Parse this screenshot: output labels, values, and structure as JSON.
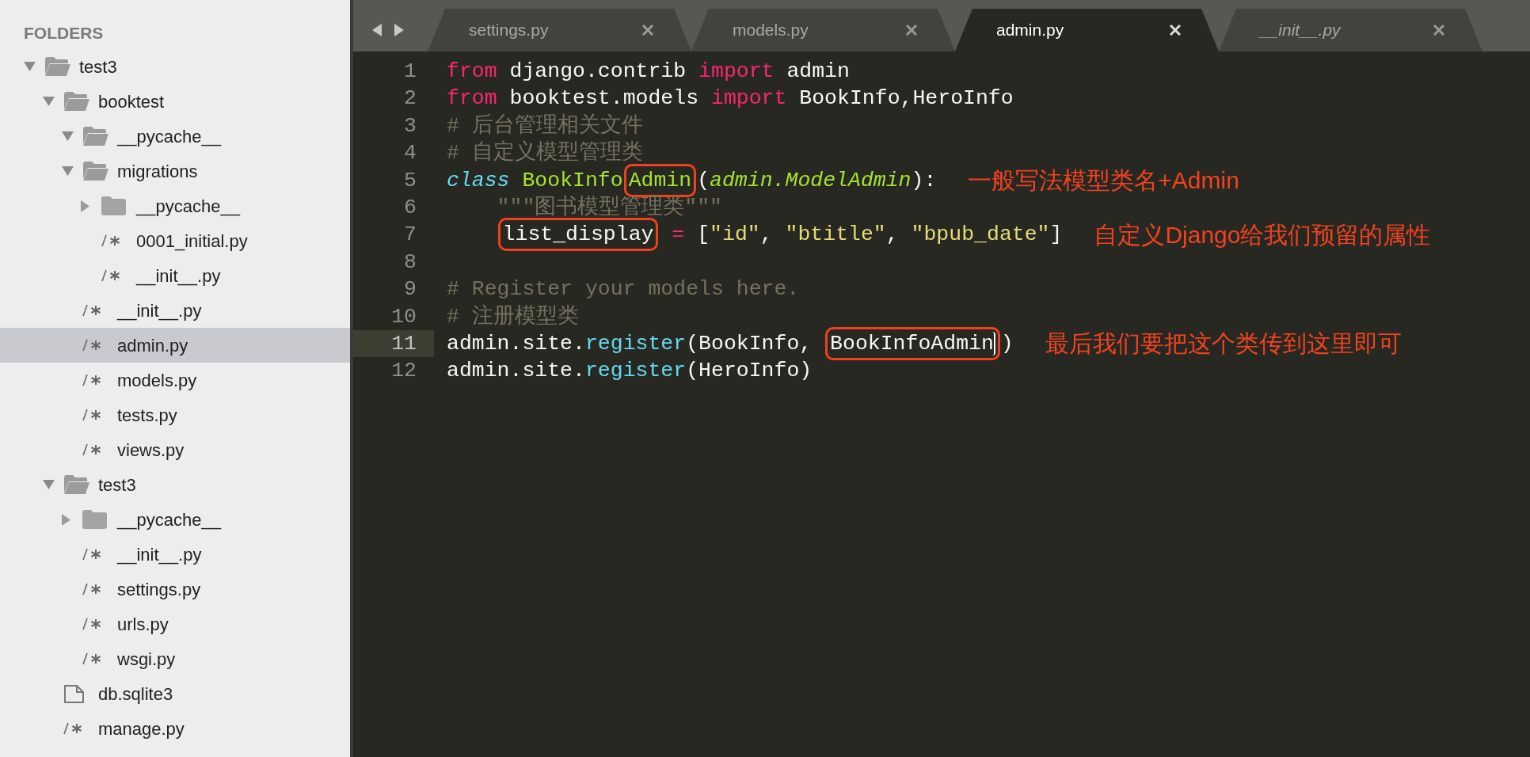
{
  "sidebar": {
    "header": "FOLDERS",
    "tree": [
      {
        "name": "test3",
        "kind": "folder",
        "expanded": true,
        "selected": false,
        "children": [
          {
            "name": "booktest",
            "kind": "folder",
            "expanded": true,
            "selected": false,
            "children": [
              {
                "name": "__pycache__",
                "kind": "folder",
                "expanded": true,
                "selected": false
              },
              {
                "name": "migrations",
                "kind": "folder",
                "expanded": true,
                "selected": false,
                "children": [
                  {
                    "name": "__pycache__",
                    "kind": "folder",
                    "expanded": false,
                    "selected": false
                  },
                  {
                    "name": "0001_initial.py",
                    "kind": "source",
                    "selected": false
                  },
                  {
                    "name": "__init__.py",
                    "kind": "source",
                    "selected": false
                  }
                ]
              },
              {
                "name": "__init__.py",
                "kind": "source",
                "selected": false
              },
              {
                "name": "admin.py",
                "kind": "source",
                "selected": true
              },
              {
                "name": "models.py",
                "kind": "source",
                "selected": false
              },
              {
                "name": "tests.py",
                "kind": "source",
                "selected": false
              },
              {
                "name": "views.py",
                "kind": "source",
                "selected": false
              }
            ]
          },
          {
            "name": "test3",
            "kind": "folder",
            "expanded": true,
            "selected": false,
            "children": [
              {
                "name": "__pycache__",
                "kind": "folder",
                "expanded": false,
                "selected": false
              },
              {
                "name": "__init__.py",
                "kind": "source",
                "selected": false
              },
              {
                "name": "settings.py",
                "kind": "source",
                "selected": false
              },
              {
                "name": "urls.py",
                "kind": "source",
                "selected": false
              },
              {
                "name": "wsgi.py",
                "kind": "source",
                "selected": false
              }
            ]
          },
          {
            "name": "db.sqlite3",
            "kind": "file",
            "selected": false
          },
          {
            "name": "manage.py",
            "kind": "source",
            "selected": false
          }
        ]
      }
    ]
  },
  "tabs": [
    {
      "label": "settings.py",
      "selected": false,
      "preview": false
    },
    {
      "label": "models.py",
      "selected": false,
      "preview": false
    },
    {
      "label": "admin.py",
      "selected": true,
      "preview": false
    },
    {
      "label": "__init__.py",
      "selected": false,
      "preview": true
    }
  ],
  "editor": {
    "lines": [
      {
        "number": "1",
        "current": false,
        "tokens": [
          {
            "text": "from",
            "kind": "keyword"
          },
          {
            "text": " django.contrib ",
            "kind": "plain"
          },
          {
            "text": "import",
            "kind": "keyword"
          },
          {
            "text": " admin",
            "kind": "plain"
          }
        ]
      },
      {
        "number": "2",
        "current": false,
        "tokens": [
          {
            "text": "from",
            "kind": "keyword"
          },
          {
            "text": " booktest.models ",
            "kind": "plain"
          },
          {
            "text": "import",
            "kind": "keyword"
          },
          {
            "text": " BookInfo,HeroInfo",
            "kind": "plain"
          }
        ]
      },
      {
        "number": "3",
        "current": false,
        "tokens": [
          {
            "text": "# 后台管理相关文件",
            "kind": "comment"
          }
        ]
      },
      {
        "number": "4",
        "current": false,
        "tokens": [
          {
            "text": "# 自定义模型管理类",
            "kind": "comment"
          }
        ]
      },
      {
        "number": "5",
        "current": false,
        "tokens": [
          {
            "text": "class",
            "kind": "storage"
          },
          {
            "text": " BookInfo",
            "kind": "entity"
          },
          {
            "text": "Admin",
            "kind": "entity",
            "boxed": true
          },
          {
            "text": "(",
            "kind": "plain"
          },
          {
            "text": "admin.ModelAdmin",
            "kind": "inherit"
          },
          {
            "text": "):",
            "kind": "plain"
          }
        ],
        "note": "一般写法模型类名+Admin"
      },
      {
        "number": "6",
        "current": false,
        "indented": true,
        "tokens": [
          {
            "text": "\"\"\"图书模型管理类\"\"\"",
            "kind": "docstring"
          }
        ]
      },
      {
        "number": "7",
        "current": false,
        "indented": true,
        "tokens": [
          {
            "text": "list_display",
            "kind": "plain",
            "boxed": true
          },
          {
            "text": " = ",
            "kind": "operator"
          },
          {
            "text": "[",
            "kind": "plain"
          },
          {
            "text": "\"id\"",
            "kind": "string"
          },
          {
            "text": ", ",
            "kind": "plain"
          },
          {
            "text": "\"btitle\"",
            "kind": "string"
          },
          {
            "text": ", ",
            "kind": "plain"
          },
          {
            "text": "\"bpub_date\"",
            "kind": "string"
          },
          {
            "text": "]",
            "kind": "plain"
          }
        ],
        "note": "自定义Django给我们预留的属性"
      },
      {
        "number": "8",
        "current": false
      },
      {
        "number": "9",
        "current": false,
        "tokens": [
          {
            "text": "# Register your models here.",
            "kind": "comment"
          }
        ]
      },
      {
        "number": "10",
        "current": false,
        "tokens": [
          {
            "text": "# 注册模型类",
            "kind": "comment"
          }
        ]
      },
      {
        "number": "11",
        "current": true,
        "tokens": [
          {
            "text": "admin.site.",
            "kind": "plain"
          },
          {
            "text": "register",
            "kind": "func"
          },
          {
            "text": "(BookInfo, ",
            "kind": "plain"
          },
          {
            "text": "BookInfoAdmin",
            "kind": "plain",
            "boxed": true,
            "cursor": true
          },
          {
            "text": ")",
            "kind": "plain"
          }
        ],
        "note": "最后我们要把这个类传到这里即可"
      },
      {
        "number": "12",
        "current": false,
        "tokens": [
          {
            "text": "admin.site.",
            "kind": "plain"
          },
          {
            "text": "register",
            "kind": "func"
          },
          {
            "text": "(HeroInfo)",
            "kind": "plain"
          }
        ]
      }
    ]
  }
}
